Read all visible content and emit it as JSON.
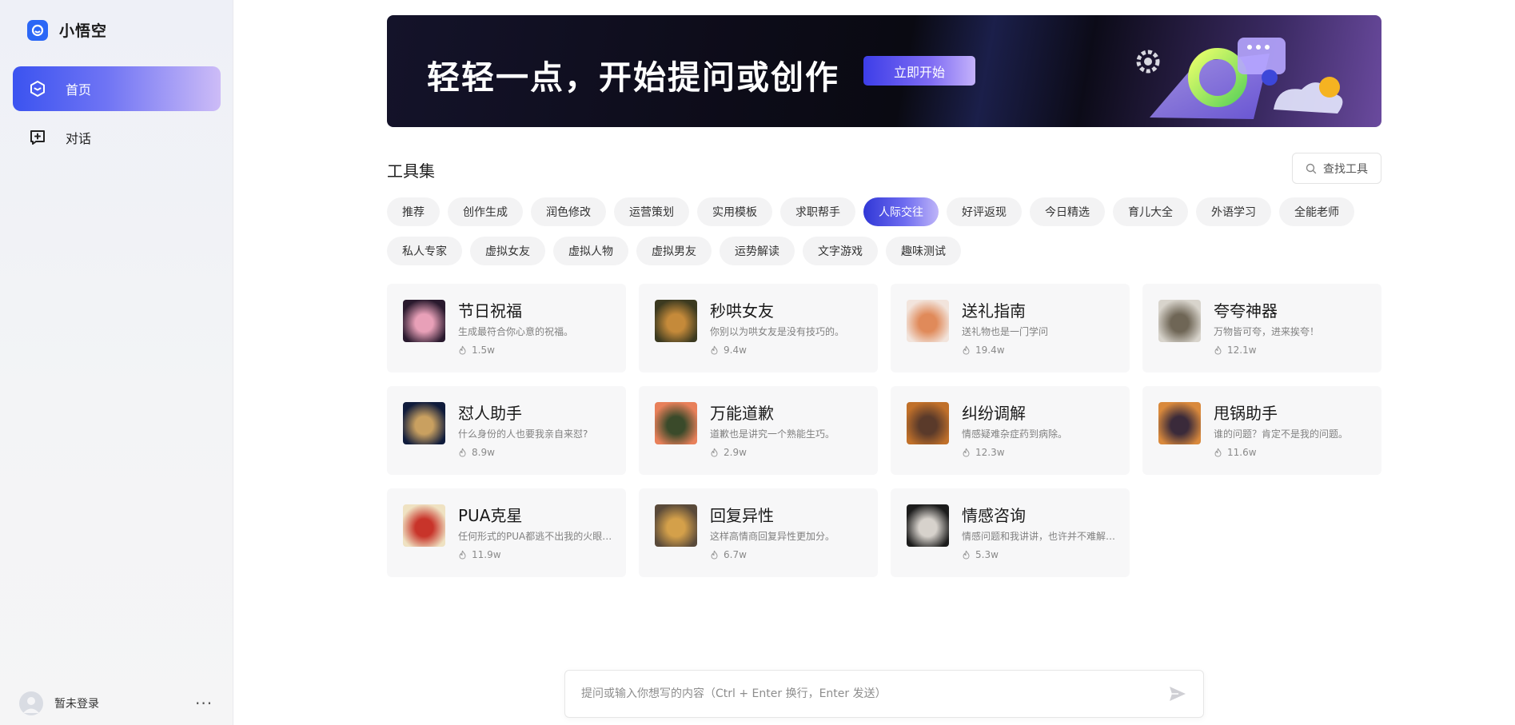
{
  "app": {
    "name": "小悟空"
  },
  "sidebar": {
    "items": [
      {
        "label": "首页",
        "icon": "home-hexagon-icon",
        "active": true
      },
      {
        "label": "对话",
        "icon": "chat-add-icon",
        "active": false
      }
    ],
    "user": {
      "name": "暂未登录"
    },
    "more": "···"
  },
  "banner": {
    "title": "轻轻一点，开始提问或创作",
    "button": "立即开始"
  },
  "tools": {
    "title": "工具集",
    "search_label": "查找工具",
    "chips_row1": [
      "推荐",
      "创作生成",
      "润色修改",
      "运营策划",
      "实用模板",
      "求职帮手",
      "人际交往",
      "好评返现",
      "今日精选",
      "育儿大全",
      "外语学习",
      "全能老师"
    ],
    "chips_row2": [
      "私人专家",
      "虚拟女友",
      "虚拟人物",
      "虚拟男友",
      "运势解读",
      "文字游戏",
      "趣味测试"
    ],
    "active_chip": "人际交往"
  },
  "cards": [
    {
      "title": "节日祝福",
      "desc": "生成最符合你心意的祝福。",
      "stat": "1.5w",
      "colors": [
        "#2a1a2e",
        "#e8a0b8"
      ]
    },
    {
      "title": "秒哄女友",
      "desc": "你别以为哄女友是没有技巧的。",
      "stat": "9.4w",
      "colors": [
        "#3c3a20",
        "#c58a3a"
      ]
    },
    {
      "title": "送礼指南",
      "desc": "送礼物也是一门学问",
      "stat": "19.4w",
      "colors": [
        "#f2e4dc",
        "#e08a5a"
      ]
    },
    {
      "title": "夸夸神器",
      "desc": "万物皆可夸，进来挨夸！",
      "stat": "12.1w",
      "colors": [
        "#d8d4cc",
        "#6f6656"
      ]
    },
    {
      "title": "怼人助手",
      "desc": "什么身份的人也要我亲自来怼?",
      "stat": "8.9w",
      "colors": [
        "#101c3c",
        "#c9a060"
      ]
    },
    {
      "title": "万能道歉",
      "desc": "道歉也是讲究一个熟能生巧。",
      "stat": "2.9w",
      "colors": [
        "#e8805a",
        "#3a4a2a"
      ]
    },
    {
      "title": "纠纷调解",
      "desc": "情感疑难杂症药到病除。",
      "stat": "12.3w",
      "colors": [
        "#c0702a",
        "#5a3a2a"
      ]
    },
    {
      "title": "甩锅助手",
      "desc": "谁的问题？肯定不是我的问题。",
      "stat": "11.6w",
      "colors": [
        "#d9893c",
        "#3a2a3a"
      ]
    },
    {
      "title": "PUA克星",
      "desc": "任何形式的PUA都逃不出我的火眼金睛。",
      "stat": "11.9w",
      "colors": [
        "#efe2c2",
        "#c8342a"
      ]
    },
    {
      "title": "回复异性",
      "desc": "这样高情商回复异性更加分。",
      "stat": "6.7w",
      "colors": [
        "#5a4a3a",
        "#d4a04a"
      ]
    },
    {
      "title": "情感咨询",
      "desc": "情感问题和我讲讲，也许并不难解决。",
      "stat": "5.3w",
      "colors": [
        "#1c1c1c",
        "#d7d2cc"
      ]
    }
  ],
  "composer": {
    "placeholder": "提问或输入你想写的内容（Ctrl + Enter 换行，Enter 发送）"
  },
  "colors": {
    "accent": "#3b53f0",
    "brand": "#2b67f6"
  }
}
